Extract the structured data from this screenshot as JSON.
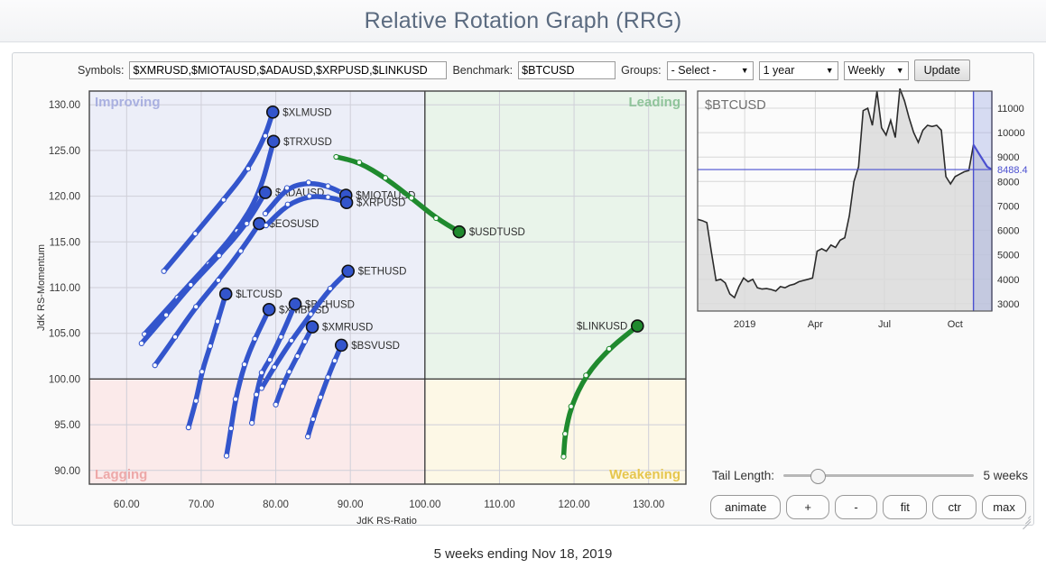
{
  "header": {
    "title": "Relative Rotation Graph (RRG)"
  },
  "toolbar": {
    "symbols_label": "Symbols:",
    "symbols_value": "$XMRUSD,$MIOTAUSD,$ADAUSD,$XRPUSD,$LINKUSD",
    "benchmark_label": "Benchmark:",
    "benchmark_value": "$BTCUSD",
    "groups_label": "Groups:",
    "groups_value": "- Select -",
    "period_value": "1 year",
    "frequency_value": "Weekly",
    "update_label": "Update"
  },
  "controls": {
    "tail_length_label": "Tail Length:",
    "tail_length_value": "5 weeks",
    "animate_label": "animate",
    "plus_label": "+",
    "minus_label": "-",
    "fit_label": "fit",
    "ctr_label": "ctr",
    "max_label": "max"
  },
  "footer": {
    "caption": "5 weeks ending Nov 18, 2019"
  },
  "colors": {
    "leading": "#e9f4ea",
    "improving": "#eceef8",
    "lagging": "#fbeaea",
    "weakening": "#fdf8e6",
    "tail_blue": "#3355cc",
    "tail_green": "#1f8a2e",
    "benchmark_line": "#4a4fd0",
    "price_line": "#2b2b2b"
  },
  "chart_data": {
    "type": "scatter",
    "title": "Relative Rotation Graph (RRG)",
    "xlabel": "JdK RS-Ratio",
    "ylabel": "JdK RS-Momentum",
    "xlim": [
      55,
      135
    ],
    "ylim": [
      88.5,
      131.5
    ],
    "xticks": [
      "60.00",
      "70.00",
      "80.00",
      "90.00",
      "100.00",
      "110.00",
      "120.00",
      "130.00"
    ],
    "yticks": [
      "90.00",
      "95.00",
      "100.00",
      "105.00",
      "110.00",
      "115.00",
      "120.00",
      "125.00",
      "130.00"
    ],
    "grid": true,
    "center": [
      100,
      100
    ],
    "quadrants": [
      {
        "name": "improving",
        "label": "Improving",
        "color": "#eceef8",
        "text_color": "#a9b0e0"
      },
      {
        "name": "leading",
        "label": "Leading",
        "color": "#e9f4ea",
        "text_color": "#8fc49a"
      },
      {
        "name": "lagging",
        "label": "Lagging",
        "color": "#fbeaea",
        "text_color": "#eda8a8"
      },
      {
        "name": "weakening",
        "label": "Weakening",
        "color": "#fdf8e6",
        "text_color": "#e6c64e"
      }
    ],
    "series": [
      {
        "name": "$XLMUSD",
        "color": "#3355cc",
        "points": [
          [
            65.0,
            111.8
          ],
          [
            69.2,
            115.9
          ],
          [
            73.0,
            119.6
          ],
          [
            76.3,
            123.0
          ],
          [
            78.6,
            126.6
          ],
          [
            79.6,
            129.2
          ]
        ],
        "label_pos": "right"
      },
      {
        "name": "$TRXUSD",
        "color": "#3355cc",
        "points": [
          [
            62.4,
            104.9
          ],
          [
            66.8,
            108.9
          ],
          [
            71.0,
            112.6
          ],
          [
            74.8,
            116.2
          ],
          [
            77.8,
            120.2
          ],
          [
            79.7,
            126.0
          ]
        ],
        "label_pos": "right"
      },
      {
        "name": "$ADAUSD",
        "color": "#3355cc",
        "points": [
          [
            62.0,
            103.9
          ],
          [
            65.3,
            107.0
          ],
          [
            68.6,
            110.3
          ],
          [
            72.4,
            113.5
          ],
          [
            76.1,
            117.0
          ],
          [
            78.6,
            120.4
          ]
        ],
        "label_pos": "right"
      },
      {
        "name": "$EOSUSD",
        "color": "#3355cc",
        "points": [
          [
            63.8,
            101.5
          ],
          [
            66.5,
            104.6
          ],
          [
            69.3,
            107.9
          ],
          [
            72.3,
            110.8
          ],
          [
            75.3,
            114.0
          ],
          [
            77.8,
            117.0
          ]
        ],
        "label_pos": "right"
      },
      {
        "name": "$LTCUSD",
        "color": "#3355cc",
        "points": [
          [
            68.3,
            94.7
          ],
          [
            69.3,
            97.6
          ],
          [
            70.1,
            100.8
          ],
          [
            71.2,
            103.6
          ],
          [
            72.2,
            106.3
          ],
          [
            73.3,
            109.3
          ]
        ],
        "label_pos": "right"
      },
      {
        "name": "$XMBUSD",
        "color": "#3355cc",
        "points": [
          [
            73.4,
            91.6
          ],
          [
            74.0,
            94.6
          ],
          [
            74.6,
            97.8
          ],
          [
            75.8,
            101.6
          ],
          [
            77.2,
            104.4
          ],
          [
            79.1,
            107.6
          ]
        ],
        "label_pos": "right"
      },
      {
        "name": "$BCHUSD",
        "color": "#3355cc",
        "points": [
          [
            76.8,
            95.2
          ],
          [
            77.4,
            98.3
          ],
          [
            78.1,
            100.7
          ],
          [
            79.2,
            102.1
          ],
          [
            80.7,
            104.6
          ],
          [
            82.6,
            108.2
          ]
        ],
        "label_pos": "right"
      },
      {
        "name": "$ETHUSD",
        "color": "#3355cc",
        "points": [
          [
            78.1,
            99.0
          ],
          [
            79.8,
            101.3
          ],
          [
            82.1,
            104.2
          ],
          [
            84.7,
            107.1
          ],
          [
            87.3,
            109.9
          ],
          [
            89.7,
            111.8
          ]
        ],
        "label_pos": "right"
      },
      {
        "name": "$XMRUSD",
        "color": "#3355cc",
        "points": [
          [
            80.0,
            97.2
          ],
          [
            80.9,
            99.2
          ],
          [
            81.8,
            100.8
          ],
          [
            82.9,
            102.5
          ],
          [
            83.9,
            104.1
          ],
          [
            84.9,
            105.7
          ]
        ],
        "label_pos": "right"
      },
      {
        "name": "$BSVUSD",
        "color": "#3355cc",
        "points": [
          [
            84.3,
            93.7
          ],
          [
            85.0,
            95.6
          ],
          [
            86.0,
            98.0
          ],
          [
            87.0,
            100.2
          ],
          [
            87.9,
            102.0
          ],
          [
            88.8,
            103.7
          ]
        ],
        "label_pos": "right"
      },
      {
        "name": "$MIOTAUSD",
        "color": "#3355cc",
        "points": [
          [
            78.6,
            118.1
          ],
          [
            81.5,
            120.9
          ],
          [
            84.4,
            121.5
          ],
          [
            87.0,
            121.1
          ],
          [
            88.8,
            120.4
          ],
          [
            89.4,
            120.1
          ]
        ],
        "label_pos": "right"
      },
      {
        "name": "$XRPUSD",
        "color": "#3355cc",
        "points": [
          [
            78.7,
            116.8
          ],
          [
            81.6,
            119.1
          ],
          [
            84.5,
            120.0
          ],
          [
            87.0,
            119.9
          ],
          [
            88.9,
            119.5
          ],
          [
            89.5,
            119.3
          ]
        ],
        "label_pos": "right"
      },
      {
        "name": "$USDTUSD",
        "color": "#1f8a2e",
        "points": [
          [
            88.1,
            124.3
          ],
          [
            91.2,
            123.7
          ],
          [
            94.7,
            122.0
          ],
          [
            98.2,
            119.8
          ],
          [
            101.5,
            117.6
          ],
          [
            104.6,
            116.1
          ]
        ],
        "label_pos": "right"
      },
      {
        "name": "$LINKUSD",
        "color": "#1f8a2e",
        "points": [
          [
            118.6,
            91.5
          ],
          [
            118.8,
            94.0
          ],
          [
            119.6,
            97.0
          ],
          [
            121.6,
            100.4
          ],
          [
            124.7,
            103.3
          ],
          [
            128.5,
            105.8
          ]
        ],
        "label_pos": "left"
      }
    ]
  },
  "benchmark_chart": {
    "type": "area",
    "symbol": "$BTCUSD",
    "last_value": "8488.49",
    "xticks": [
      "2019",
      "Apr",
      "Jul",
      "Oct"
    ],
    "yticks": [
      "11000",
      "10000",
      "9000",
      "8000",
      "7000",
      "6000",
      "5000",
      "4000",
      "3000"
    ],
    "ylim": [
      2700,
      11700
    ],
    "grid": true,
    "values": [
      6450,
      6400,
      6320,
      5100,
      3950,
      4000,
      3850,
      3400,
      3250,
      3700,
      4050,
      3900,
      4000,
      3650,
      3600,
      3620,
      3580,
      3520,
      3700,
      3650,
      3750,
      3800,
      3900,
      3950,
      4000,
      4050,
      5150,
      5250,
      5150,
      5400,
      5300,
      5600,
      5700,
      6600,
      8000,
      8600,
      10900,
      11000,
      10300,
      11700,
      10200,
      9900,
      10500,
      9800,
      11800,
      11300,
      10600,
      10000,
      9600,
      10100,
      10300,
      10250,
      10300,
      10100,
      8200,
      7900,
      8200,
      8300,
      8400,
      8450,
      9500,
      9200,
      8900,
      8600,
      8488
    ],
    "highlight_start_index": 60
  }
}
